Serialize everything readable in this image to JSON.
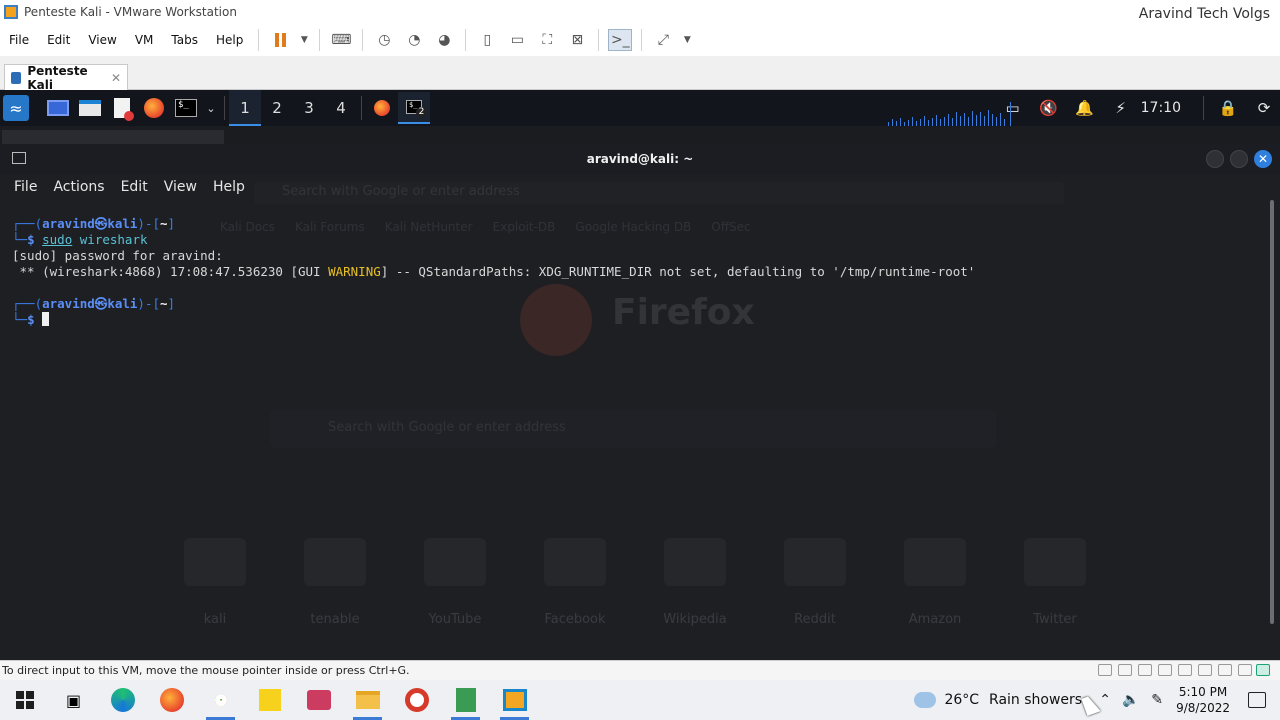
{
  "vmware": {
    "title": "Penteste Kali - VMware Workstation",
    "watermark": "Aravind Tech Volgs",
    "menu": [
      "File",
      "Edit",
      "View",
      "VM",
      "Tabs",
      "Help"
    ],
    "tab_label": "Penteste Kali",
    "tab_close": "✕",
    "status_text": "To direct input to this VM, move the mouse pointer inside or press Ctrl+G."
  },
  "kali_panel": {
    "workspaces": [
      "1",
      "2",
      "3",
      "4"
    ],
    "active_workspace": "1",
    "terminal_badge": "2",
    "clock": "17:10"
  },
  "terminal": {
    "title": "aravind@kali: ~",
    "menu": [
      "File",
      "Actions",
      "Edit",
      "View",
      "Help"
    ],
    "prompt_user": "aravind",
    "prompt_at": "㉿",
    "prompt_host": "kali",
    "prompt_dir": "~",
    "command_sudo": "sudo",
    "command_arg": "wireshark",
    "line_sudo_password": "[sudo] password for aravind:",
    "warn_prefix": " ** (wireshark:4868) 17:08:47.536230 [GUI ",
    "warn_word": "WARNING",
    "warn_suffix": "] -- QStandardPaths: XDG_RUNTIME_DIR not set, defaulting to '/tmp/runtime-root'"
  },
  "firefox_ghost": {
    "search_placeholder": "Search with Google or enter address",
    "search_placeholder2": "Search with Google or enter address",
    "brand": "Firefox",
    "bookmarks": [
      "Kali Docs",
      "Kali Forums",
      "Kali NetHunter",
      "Exploit-DB",
      "Google Hacking DB",
      "OffSec"
    ],
    "shortcuts": [
      "kali",
      "tenable",
      "YouTube",
      "Facebook",
      "Wikipedia",
      "Reddit",
      "Amazon",
      "Twitter"
    ]
  },
  "windows_taskbar": {
    "temperature": "26°C",
    "weather": "Rain showers",
    "time": "5:10 PM",
    "date": "9/8/2022"
  }
}
